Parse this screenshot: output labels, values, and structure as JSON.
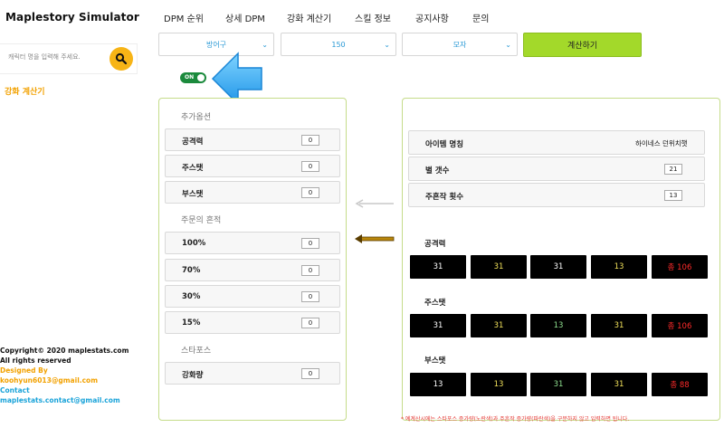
{
  "brand": "Maplestory Simulator",
  "nav": [
    "DPM 순위",
    "상세 DPM",
    "강화 계산기",
    "스킬 정보",
    "공지사항",
    "문의"
  ],
  "sidebar": {
    "search_placeholder": "캐릭터 명을 입력해 주세요.",
    "link": "강화 계산기",
    "footer": {
      "copyright": "Copyright© 2020 maplestats.com",
      "rights": "All rights reserved",
      "designed_label": "Designed By",
      "designed_email": "koohyun6013@gmail.com",
      "contact_label": "Contact",
      "contact_email": "maplestats.contact@gmail.com"
    }
  },
  "controls": {
    "dropdowns": [
      {
        "value": "방어구"
      },
      {
        "value": "150"
      },
      {
        "value": "모자"
      }
    ],
    "calc_button": "계산하기",
    "toggle_label": "ON"
  },
  "left_panel": {
    "sections": [
      {
        "title": "추가옵션",
        "rows": [
          {
            "label": "공격력",
            "value": "0"
          },
          {
            "label": "주스탯",
            "value": "0"
          },
          {
            "label": "부스탯",
            "value": "0"
          }
        ]
      },
      {
        "title": "주문의 흔적",
        "rows": [
          {
            "label": "100%",
            "value": "0"
          },
          {
            "label": "70%",
            "value": "0"
          },
          {
            "label": "30%",
            "value": "0"
          },
          {
            "label": "15%",
            "value": "0"
          }
        ]
      },
      {
        "title": "스타포스",
        "rows": [
          {
            "label": "강화량",
            "value": "0"
          }
        ]
      }
    ]
  },
  "right_panel": {
    "item_name_label": "아이템 명칭",
    "item_name_value": "하이네스 던위치햇",
    "star_label": "별 갯수",
    "star_value": "21",
    "scroll_label": "주흔작 횟수",
    "scroll_value": "13",
    "stats": [
      {
        "title": "공격력",
        "cells": [
          "31",
          "31",
          "31",
          "13",
          "총 106"
        ]
      },
      {
        "title": "주스탯",
        "cells": [
          "31",
          "31",
          "13",
          "31",
          "총 106"
        ]
      },
      {
        "title": "부스탯",
        "cells": [
          "13",
          "13",
          "31",
          "31",
          "총 88"
        ]
      }
    ],
    "note": "* 예계산시에는 스타포스 증가량(노란색)과 주흔작 증가량(파란색)을 구분하지 않고 입력하면 됩니다."
  },
  "colors": {
    "accent_green": "#a3d92a",
    "orange": "#f2a100",
    "blue": "#1aa3d9",
    "cell_red": "#ff2a2a",
    "cell_yellow": "#f0e05a",
    "cell_green": "#8fe08f",
    "cell_white": "#ffffff"
  }
}
